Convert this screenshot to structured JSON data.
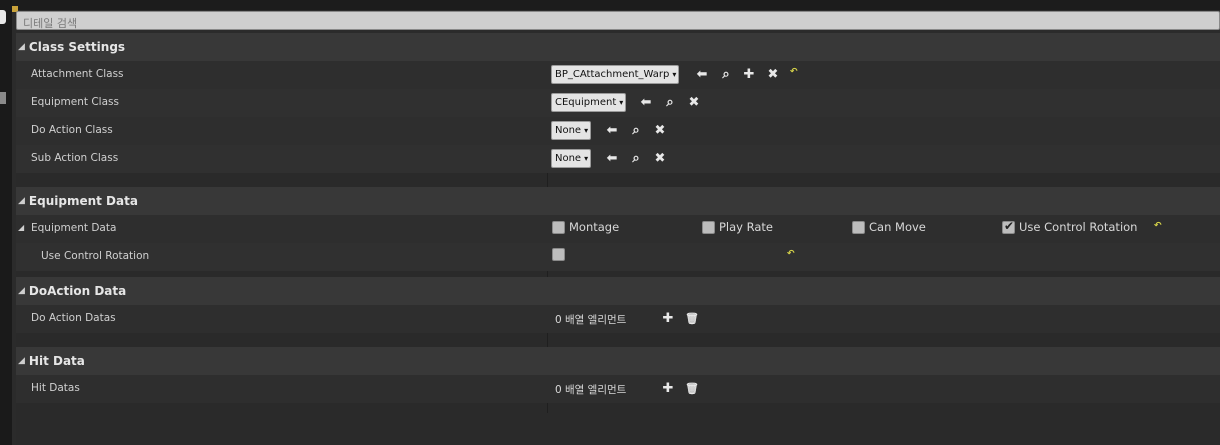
{
  "search": {
    "placeholder": "디테일 검색"
  },
  "categories": {
    "class_settings": {
      "title": "Class Settings",
      "rows": [
        {
          "label": "Attachment Class",
          "value": "BP_CAttachment_Warp"
        },
        {
          "label": "Equipment Class",
          "value": "CEquipment"
        },
        {
          "label": "Do Action Class",
          "value": "None"
        },
        {
          "label": "Sub Action Class",
          "value": "None"
        }
      ]
    },
    "equipment_data": {
      "title": "Equipment Data",
      "struct_label": "Equipment Data",
      "flags": [
        {
          "label": "Montage",
          "checked": false
        },
        {
          "label": "Play Rate",
          "checked": false
        },
        {
          "label": "Can Move",
          "checked": false
        },
        {
          "label": "Use Control Rotation",
          "checked": true
        }
      ],
      "sub_label": "Use Control Rotation"
    },
    "doaction_data": {
      "title": "DoAction Data",
      "row_label": "Do Action Datas",
      "array_text": "0 배열 엘리먼트"
    },
    "hit_data": {
      "title": "Hit Data",
      "row_label": "Hit Datas",
      "array_text": "0 배열 엘리먼트"
    }
  },
  "icons": {
    "combo_arrow": "▾",
    "use_selected": "⬅",
    "browse": "⌕",
    "add": "✚",
    "clear": "✖",
    "reset": "↶",
    "delete": "🗑",
    "expand": "◢"
  }
}
